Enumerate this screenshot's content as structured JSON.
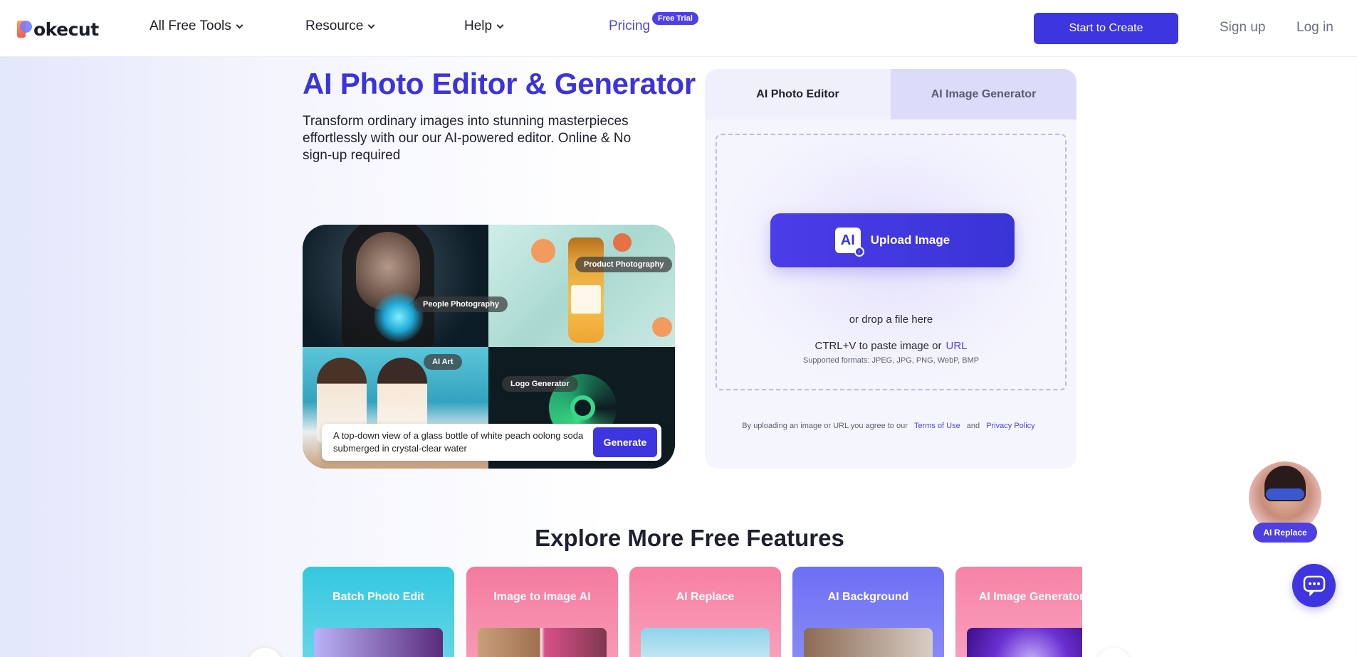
{
  "header": {
    "logo_text": "okecut",
    "nav": {
      "all_free_tools": "All Free Tools",
      "resource": "Resource",
      "help": "Help",
      "pricing": "Pricing",
      "free_trial_badge": "Free Trial"
    },
    "start_button": "Start to Create",
    "sign_up": "Sign up",
    "log_in": "Log in"
  },
  "hero": {
    "title": "AI Photo Editor & Generator",
    "subtitle": "Transform ordinary images into stunning masterpieces effortlessly with our our AI-powered editor. Online & No sign-up required",
    "collage": {
      "chips": {
        "people": "People Photography",
        "product": "Product Photography",
        "ai_art": "AI Art",
        "logo": "Logo Generator"
      },
      "prompt": "A top-down view of a glass bottle of white peach oolong soda submerged in crystal-clear water",
      "generate_button": "Generate"
    }
  },
  "panel": {
    "tab_editor": "AI Photo Editor",
    "tab_generator": "AI Image Generator",
    "upload_button": "Upload Image",
    "upload_icon_text": "AI",
    "drop_text": "or drop a file here",
    "paste_text": "CTRL+V to paste image or",
    "url_link": "URL",
    "formats": "Supported formats: JPEG, JPG, PNG, WebP, BMP",
    "agree_text": "By uploading an image or URL you agree to our",
    "terms": "Terms of Use",
    "and": "and",
    "privacy": "Privacy Policy"
  },
  "explore": {
    "title": "Explore More Free Features",
    "cards": [
      {
        "title": "Batch Photo Edit"
      },
      {
        "title": "Image to Image AI"
      },
      {
        "title": "AI Replace"
      },
      {
        "title": "AI Background"
      },
      {
        "title": "AI Image Generator"
      }
    ],
    "prev_arrow": "‹",
    "next_arrow": "›"
  },
  "floating": {
    "ai_replace_label": "AI Replace"
  },
  "colors": {
    "accent": "#3d35e0",
    "title": "#3b34dc",
    "link": "#4a47e0"
  }
}
